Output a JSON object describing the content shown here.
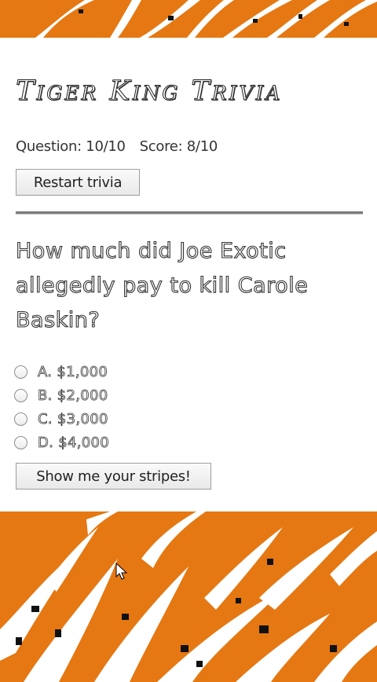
{
  "page": {
    "title": "Tiger King Trivia"
  },
  "status": {
    "question": "Question: 10/10",
    "score": "Score: 8/10"
  },
  "buttons": {
    "restart_label": "Restart trivia",
    "submit_label": "Show me your stripes!"
  },
  "question": {
    "text": "How much did Joe Exotic allegedly pay to kill Carole Baskin?",
    "options": [
      {
        "label": "A. $1,000"
      },
      {
        "label": "B. $2,000"
      },
      {
        "label": "C. $3,000"
      },
      {
        "label": "D. $4,000"
      }
    ]
  },
  "colors": {
    "background": "#e57812",
    "stripes": "#ffffff",
    "panel": "#ffffff"
  }
}
